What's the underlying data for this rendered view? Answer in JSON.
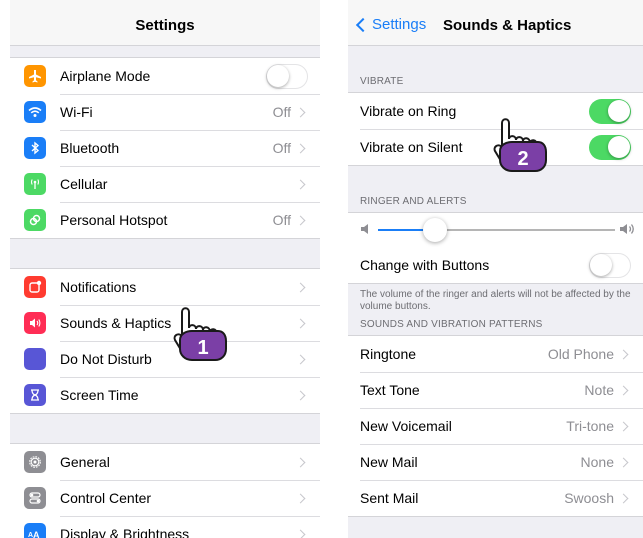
{
  "left_screen": {
    "title": "Settings",
    "groups": [
      [
        {
          "label": "Airplane Mode",
          "icon": "airplane-icon",
          "icon_color": "#ff9500",
          "control": "toggle",
          "toggle_on": false
        },
        {
          "label": "Wi-Fi",
          "icon": "wifi-icon",
          "icon_color": "#1a7ef7",
          "value": "Off",
          "control": "chevron"
        },
        {
          "label": "Bluetooth",
          "icon": "bluetooth-icon",
          "icon_color": "#1a7ef7",
          "value": "Off",
          "control": "chevron"
        },
        {
          "label": "Cellular",
          "icon": "cellular-icon",
          "icon_color": "#4cd964",
          "control": "chevron"
        },
        {
          "label": "Personal Hotspot",
          "icon": "hotspot-icon",
          "icon_color": "#4cd964",
          "value": "Off",
          "control": "chevron"
        }
      ],
      [
        {
          "label": "Notifications",
          "icon": "notifications-icon",
          "icon_color": "#ff3b30",
          "control": "chevron"
        },
        {
          "label": "Sounds & Haptics",
          "icon": "sounds-icon",
          "icon_color": "#ff2d55",
          "control": "chevron"
        },
        {
          "label": "Do Not Disturb",
          "icon": "moon-icon",
          "icon_color": "#5856d6",
          "control": "chevron"
        },
        {
          "label": "Screen Time",
          "icon": "hourglass-icon",
          "icon_color": "#5856d6",
          "control": "chevron"
        }
      ],
      [
        {
          "label": "General",
          "icon": "gear-icon",
          "icon_color": "#8e8e93",
          "control": "chevron"
        },
        {
          "label": "Control Center",
          "icon": "control-center-icon",
          "icon_color": "#8e8e93",
          "control": "chevron"
        },
        {
          "label": "Display & Brightness",
          "icon": "display-icon",
          "icon_color": "#1a7ef7",
          "control": "chevron"
        }
      ]
    ]
  },
  "right_screen": {
    "back_label": "Settings",
    "title": "Sounds & Haptics",
    "vibrate_header": "VIBRATE",
    "vibrate_rows": [
      {
        "label": "Vibrate on Ring",
        "toggle_on": true
      },
      {
        "label": "Vibrate on Silent",
        "toggle_on": true
      }
    ],
    "ringer_header": "RINGER AND ALERTS",
    "ringer_volume": 0.24,
    "change_with_buttons": {
      "label": "Change with Buttons",
      "toggle_on": false
    },
    "ringer_note": "The volume of the ringer and alerts will not be affected by the volume buttons.",
    "patterns_header": "SOUNDS AND VIBRATION PATTERNS",
    "pattern_rows": [
      {
        "label": "Ringtone",
        "value": "Old Phone"
      },
      {
        "label": "Text Tone",
        "value": "Note"
      },
      {
        "label": "New Voicemail",
        "value": "Tri-tone"
      },
      {
        "label": "New Mail",
        "value": "None"
      },
      {
        "label": "Sent Mail",
        "value": "Swoosh"
      }
    ]
  },
  "callouts": {
    "step1": "1",
    "step2": "2"
  },
  "colors": {
    "accent": "#1a7ef7",
    "toggle_on": "#4cd964",
    "callout": "#7b3fa6"
  }
}
